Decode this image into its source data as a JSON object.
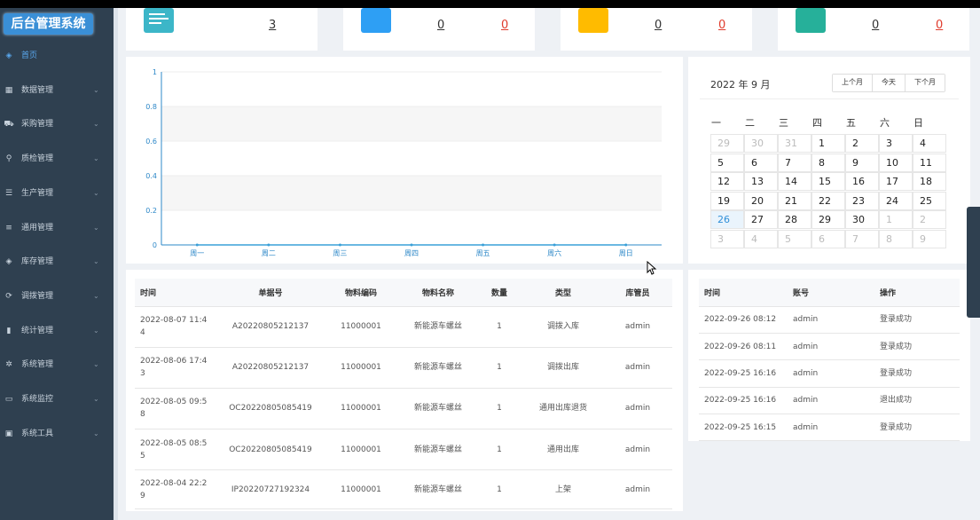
{
  "sidebar": {
    "logo": "后台管理系统",
    "items": [
      {
        "label": "首页",
        "icon": "dashboard-icon"
      },
      {
        "label": "数据管理",
        "icon": "grid-icon"
      },
      {
        "label": "采购管理",
        "icon": "cart-icon"
      },
      {
        "label": "质检管理",
        "icon": "search-icon"
      },
      {
        "label": "生产管理",
        "icon": "sliders-icon"
      },
      {
        "label": "通用管理",
        "icon": "list-icon"
      },
      {
        "label": "库存管理",
        "icon": "layers-icon"
      },
      {
        "label": "调拨管理",
        "icon": "circle-arrows-icon"
      },
      {
        "label": "统计管理",
        "icon": "bar-chart-icon"
      },
      {
        "label": "系统管理",
        "icon": "gear-icon"
      },
      {
        "label": "系统监控",
        "icon": "monitor-icon"
      },
      {
        "label": "系统工具",
        "icon": "toolbox-icon"
      }
    ]
  },
  "stats": [
    {
      "value": "3",
      "color": "#3cb6c8"
    },
    {
      "value1": "0",
      "value2": "0",
      "color": "#2e9ff4"
    },
    {
      "value1": "0",
      "value2": "0",
      "color": "#ffbb00"
    },
    {
      "value1": "0",
      "value2": "0",
      "color": "#26b09a"
    }
  ],
  "chart_data": {
    "type": "line",
    "categories": [
      "周一",
      "周二",
      "周三",
      "周四",
      "周五",
      "周六",
      "周日"
    ],
    "series": [
      {
        "values": [
          0,
          0,
          0,
          0,
          0,
          0,
          0
        ]
      }
    ],
    "ylim": [
      0,
      1
    ],
    "yticks": [
      "0",
      "0.2",
      "0.4",
      "0.6",
      "0.8",
      "1"
    ],
    "title": "",
    "xlabel": "",
    "ylabel": "",
    "grid": "alternating bands"
  },
  "calendar": {
    "title": "2022 年 9 月",
    "buttons": [
      "上个月",
      "今天",
      "下个月"
    ],
    "weekdays": [
      "一",
      "二",
      "三",
      "四",
      "五",
      "六",
      "日"
    ],
    "days": [
      [
        "29",
        "30",
        "31",
        "1",
        "2",
        "3",
        "4"
      ],
      [
        "5",
        "6",
        "7",
        "8",
        "9",
        "10",
        "11"
      ],
      [
        "12",
        "13",
        "14",
        "15",
        "16",
        "17",
        "18"
      ],
      [
        "19",
        "20",
        "21",
        "22",
        "23",
        "24",
        "25"
      ],
      [
        "26",
        "27",
        "28",
        "29",
        "30",
        "1",
        "2"
      ],
      [
        "3",
        "4",
        "5",
        "6",
        "7",
        "8",
        "9"
      ]
    ],
    "today": "26"
  },
  "records": {
    "headers": [
      "时间",
      "单据号",
      "物料编码",
      "物料名称",
      "数量",
      "类型",
      "库管员"
    ],
    "rows": [
      [
        "2022-08-07 11:4\n4",
        "A20220805212137",
        "11000001",
        "新能源车螺丝",
        "1",
        "调拨入库",
        "admin"
      ],
      [
        "2022-08-06 17:4\n3",
        "A20220805212137",
        "11000001",
        "新能源车螺丝",
        "1",
        "调拨出库",
        "admin"
      ],
      [
        "2022-08-05 09:5\n8",
        "OC20220805085419",
        "11000001",
        "新能源车螺丝",
        "1",
        "通用出库退货",
        "admin"
      ],
      [
        "2022-08-05 08:5\n5",
        "OC20220805085419",
        "11000001",
        "新能源车螺丝",
        "1",
        "通用出库",
        "admin"
      ],
      [
        "2022-08-04 22:2\n9",
        "IP20220727192324",
        "11000001",
        "新能源车螺丝",
        "1",
        "上架",
        "admin"
      ]
    ]
  },
  "logins": {
    "headers": [
      "时间",
      "账号",
      "操作"
    ],
    "rows": [
      [
        "2022-09-26 08:12",
        "admin",
        "登录成功"
      ],
      [
        "2022-09-26 08:11",
        "admin",
        "登录成功"
      ],
      [
        "2022-09-25 16:16",
        "admin",
        "登录成功"
      ],
      [
        "2022-09-25 16:16",
        "admin",
        "退出成功"
      ],
      [
        "2022-09-25 16:15",
        "admin",
        "登录成功"
      ]
    ]
  }
}
